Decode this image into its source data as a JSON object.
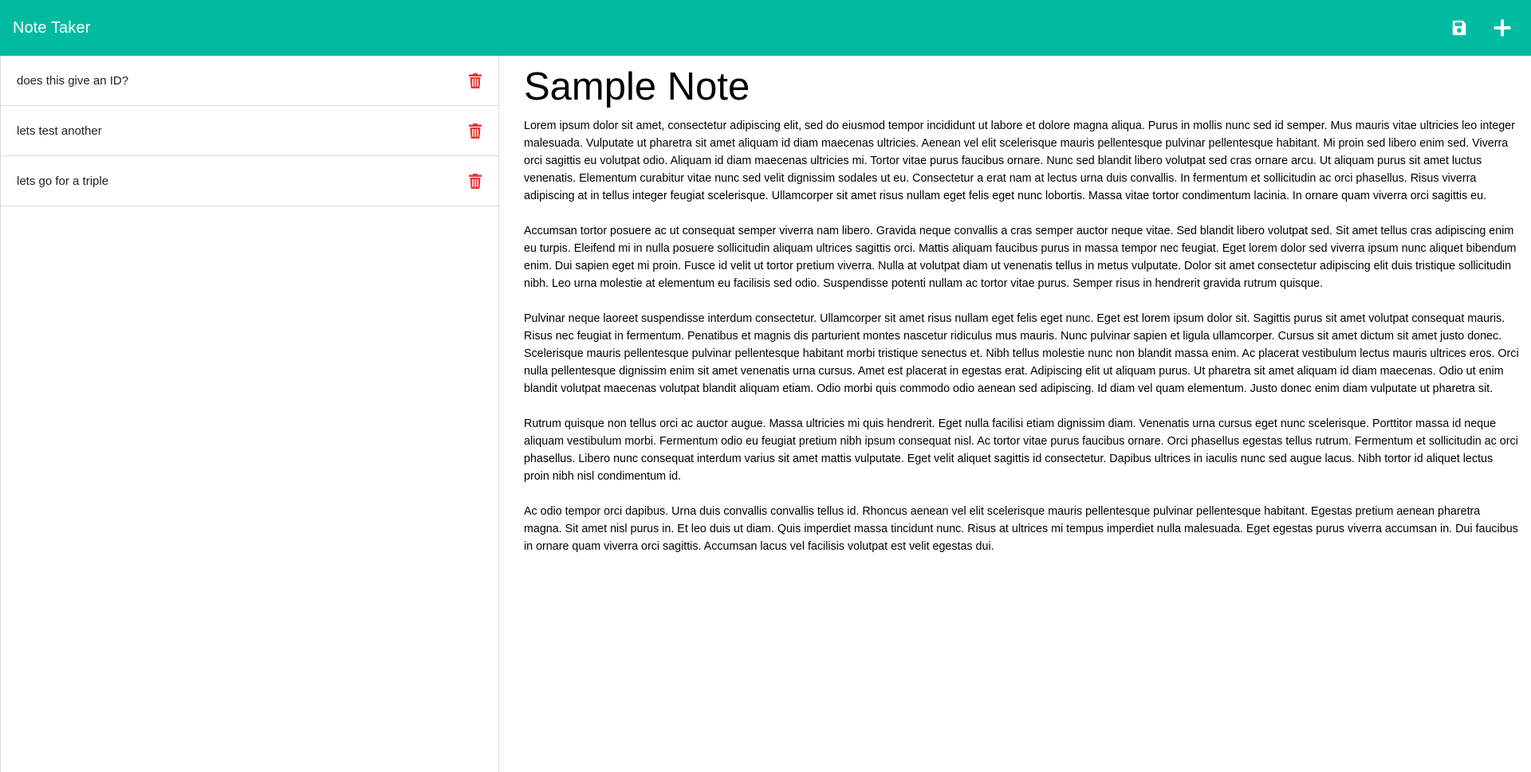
{
  "app": {
    "title": "Note Taker",
    "accent_color": "#00bba0",
    "delete_color": "#e53935"
  },
  "toolbar": {
    "save_icon": "floppy-disk-icon",
    "new_icon": "plus-icon"
  },
  "notes": [
    {
      "title": "does this give an ID?"
    },
    {
      "title": "lets test another"
    },
    {
      "title": "lets go for a triple"
    }
  ],
  "active_note": {
    "title": "Sample Note",
    "paragraphs": [
      "Lorem ipsum dolor sit amet, consectetur adipiscing elit, sed do eiusmod tempor incididunt ut labore et dolore magna aliqua. Purus in mollis nunc sed id semper. Mus mauris vitae ultricies leo integer malesuada. Vulputate ut pharetra sit amet aliquam id diam maecenas ultricies. Aenean vel elit scelerisque mauris pellentesque pulvinar pellentesque habitant. Mi proin sed libero enim sed. Viverra orci sagittis eu volutpat odio. Aliquam id diam maecenas ultricies mi. Tortor vitae purus faucibus ornare. Nunc sed blandit libero volutpat sed cras ornare arcu. Ut aliquam purus sit amet luctus venenatis. Elementum curabitur vitae nunc sed velit dignissim sodales ut eu. Consectetur a erat nam at lectus urna duis convallis. In fermentum et sollicitudin ac orci phasellus. Risus viverra adipiscing at in tellus integer feugiat scelerisque. Ullamcorper sit amet risus nullam eget felis eget nunc lobortis. Massa vitae tortor condimentum lacinia. In ornare quam viverra orci sagittis eu.",
      "Accumsan tortor posuere ac ut consequat semper viverra nam libero. Gravida neque convallis a cras semper auctor neque vitae. Sed blandit libero volutpat sed. Sit amet tellus cras adipiscing enim eu turpis. Eleifend mi in nulla posuere sollicitudin aliquam ultrices sagittis orci. Mattis aliquam faucibus purus in massa tempor nec feugiat. Eget lorem dolor sed viverra ipsum nunc aliquet bibendum enim. Dui sapien eget mi proin. Fusce id velit ut tortor pretium viverra. Nulla at volutpat diam ut venenatis tellus in metus vulputate. Dolor sit amet consectetur adipiscing elit duis tristique sollicitudin nibh. Leo urna molestie at elementum eu facilisis sed odio. Suspendisse potenti nullam ac tortor vitae purus. Semper risus in hendrerit gravida rutrum quisque.",
      "Pulvinar neque laoreet suspendisse interdum consectetur. Ullamcorper sit amet risus nullam eget felis eget nunc. Eget est lorem ipsum dolor sit. Sagittis purus sit amet volutpat consequat mauris. Risus nec feugiat in fermentum. Penatibus et magnis dis parturient montes nascetur ridiculus mus mauris. Nunc pulvinar sapien et ligula ullamcorper. Cursus sit amet dictum sit amet justo donec. Scelerisque mauris pellentesque pulvinar pellentesque habitant morbi tristique senectus et. Nibh tellus molestie nunc non blandit massa enim. Ac placerat vestibulum lectus mauris ultrices eros. Orci nulla pellentesque dignissim enim sit amet venenatis urna cursus. Amet est placerat in egestas erat. Adipiscing elit ut aliquam purus. Ut pharetra sit amet aliquam id diam maecenas. Odio ut enim blandit volutpat maecenas volutpat blandit aliquam etiam. Odio morbi quis commodo odio aenean sed adipiscing. Id diam vel quam elementum. Justo donec enim diam vulputate ut pharetra sit.",
      "Rutrum quisque non tellus orci ac auctor augue. Massa ultricies mi quis hendrerit. Eget nulla facilisi etiam dignissim diam. Venenatis urna cursus eget nunc scelerisque. Porttitor massa id neque aliquam vestibulum morbi. Fermentum odio eu feugiat pretium nibh ipsum consequat nisl. Ac tortor vitae purus faucibus ornare. Orci phasellus egestas tellus rutrum. Fermentum et sollicitudin ac orci phasellus. Libero nunc consequat interdum varius sit amet mattis vulputate. Eget velit aliquet sagittis id consectetur. Dapibus ultrices in iaculis nunc sed augue lacus. Nibh tortor id aliquet lectus proin nibh nisl condimentum id.",
      "Ac odio tempor orci dapibus. Urna duis convallis convallis tellus id. Rhoncus aenean vel elit scelerisque mauris pellentesque pulvinar pellentesque habitant. Egestas pretium aenean pharetra magna. Sit amet nisl purus in. Et leo duis ut diam. Quis imperdiet massa tincidunt nunc. Risus at ultrices mi tempus imperdiet nulla malesuada. Eget egestas purus viverra accumsan in. Dui faucibus in ornare quam viverra orci sagittis. Accumsan lacus vel facilisis volutpat est velit egestas dui."
    ]
  }
}
